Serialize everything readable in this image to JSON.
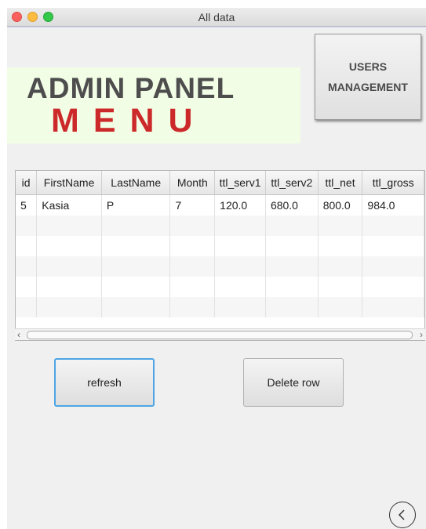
{
  "window": {
    "title": "All data"
  },
  "banner": {
    "line1": "ADMIN PANEL",
    "line2": "MENU"
  },
  "buttons": {
    "users_line1": "USERS",
    "users_line2": "MANAGEMENT",
    "refresh": "refresh",
    "delete_row": "Delete row"
  },
  "table": {
    "columns": [
      "id",
      "FirstName",
      "LastName",
      "Month",
      "ttl_serv1",
      "ttl_serv2",
      "ttl_net",
      "ttl_gross"
    ],
    "rows": [
      [
        "5",
        "Kasia",
        "P",
        "7",
        "120.0",
        "680.0",
        "800.0",
        "984.0"
      ]
    ]
  },
  "icons": {
    "back": "back-arrow-icon",
    "scroll_left": "chevron-left-icon",
    "scroll_right": "chevron-right-icon"
  }
}
